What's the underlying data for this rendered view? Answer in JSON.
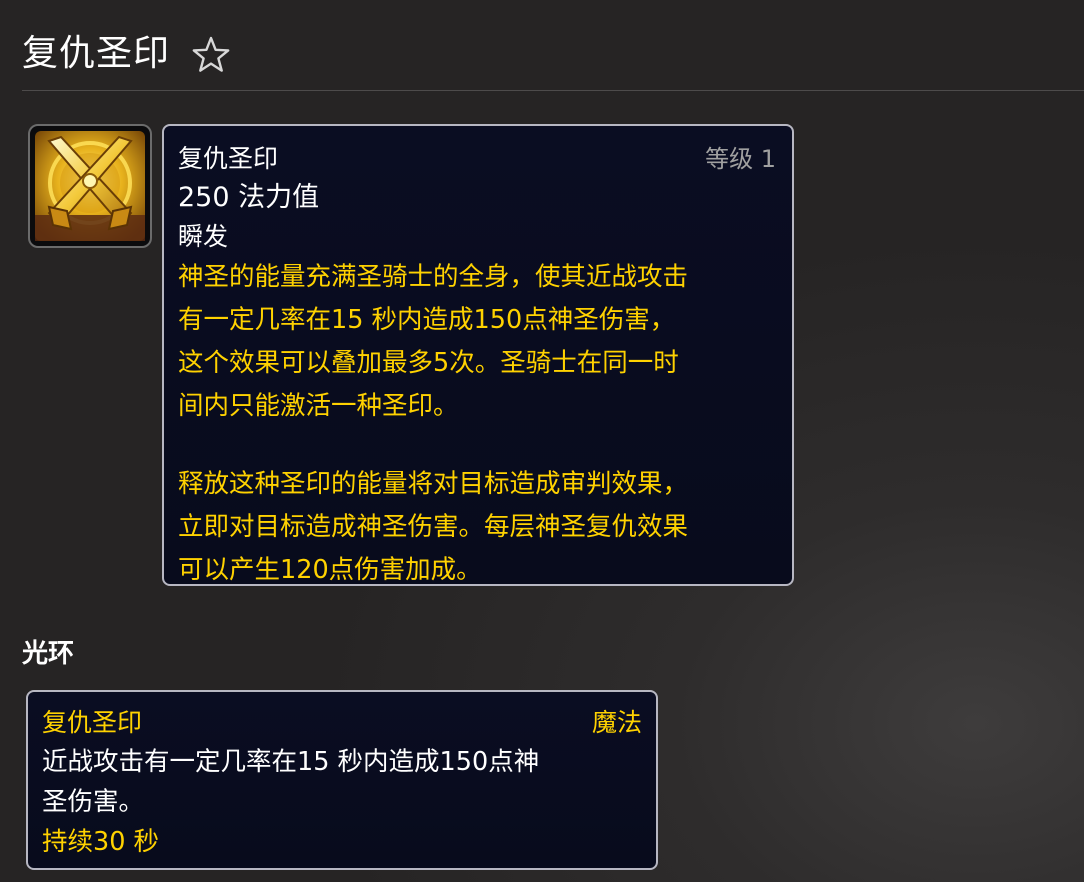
{
  "header": {
    "title": "复仇圣印",
    "favorite_icon": "star-outline-icon"
  },
  "spell": {
    "icon": "crossed-swords-icon",
    "name": "复仇圣印",
    "rank": "等级 1",
    "cost": "250 法力值",
    "cast_time": "瞬发",
    "description": [
      "神圣的能量充满圣骑士的全身，使其近战攻击",
      "有一定几率在15 秒内造成150点神圣伤害，",
      "这个效果可以叠加最多5次。圣骑士在同一时",
      "间内只能激活一种圣印。",
      "释放这种圣印的能量将对目标造成审判效果，",
      "立即对目标造成神圣伤害。每层神圣复仇效果",
      "可以产生120点伤害加成。"
    ]
  },
  "aura_section": {
    "title": "光环"
  },
  "aura": {
    "name": "复仇圣印",
    "type": "魔法",
    "description": [
      "近战攻击有一定几率在15 秒内造成150点神",
      "圣伤害。"
    ],
    "duration": "持续30 秒"
  },
  "colors": {
    "background": "#262424",
    "tooltip_bg": "#0a0d22",
    "tooltip_border": "#b7b7c2",
    "gold_text": "#ffd200",
    "rank_text": "#a0a0a0"
  }
}
